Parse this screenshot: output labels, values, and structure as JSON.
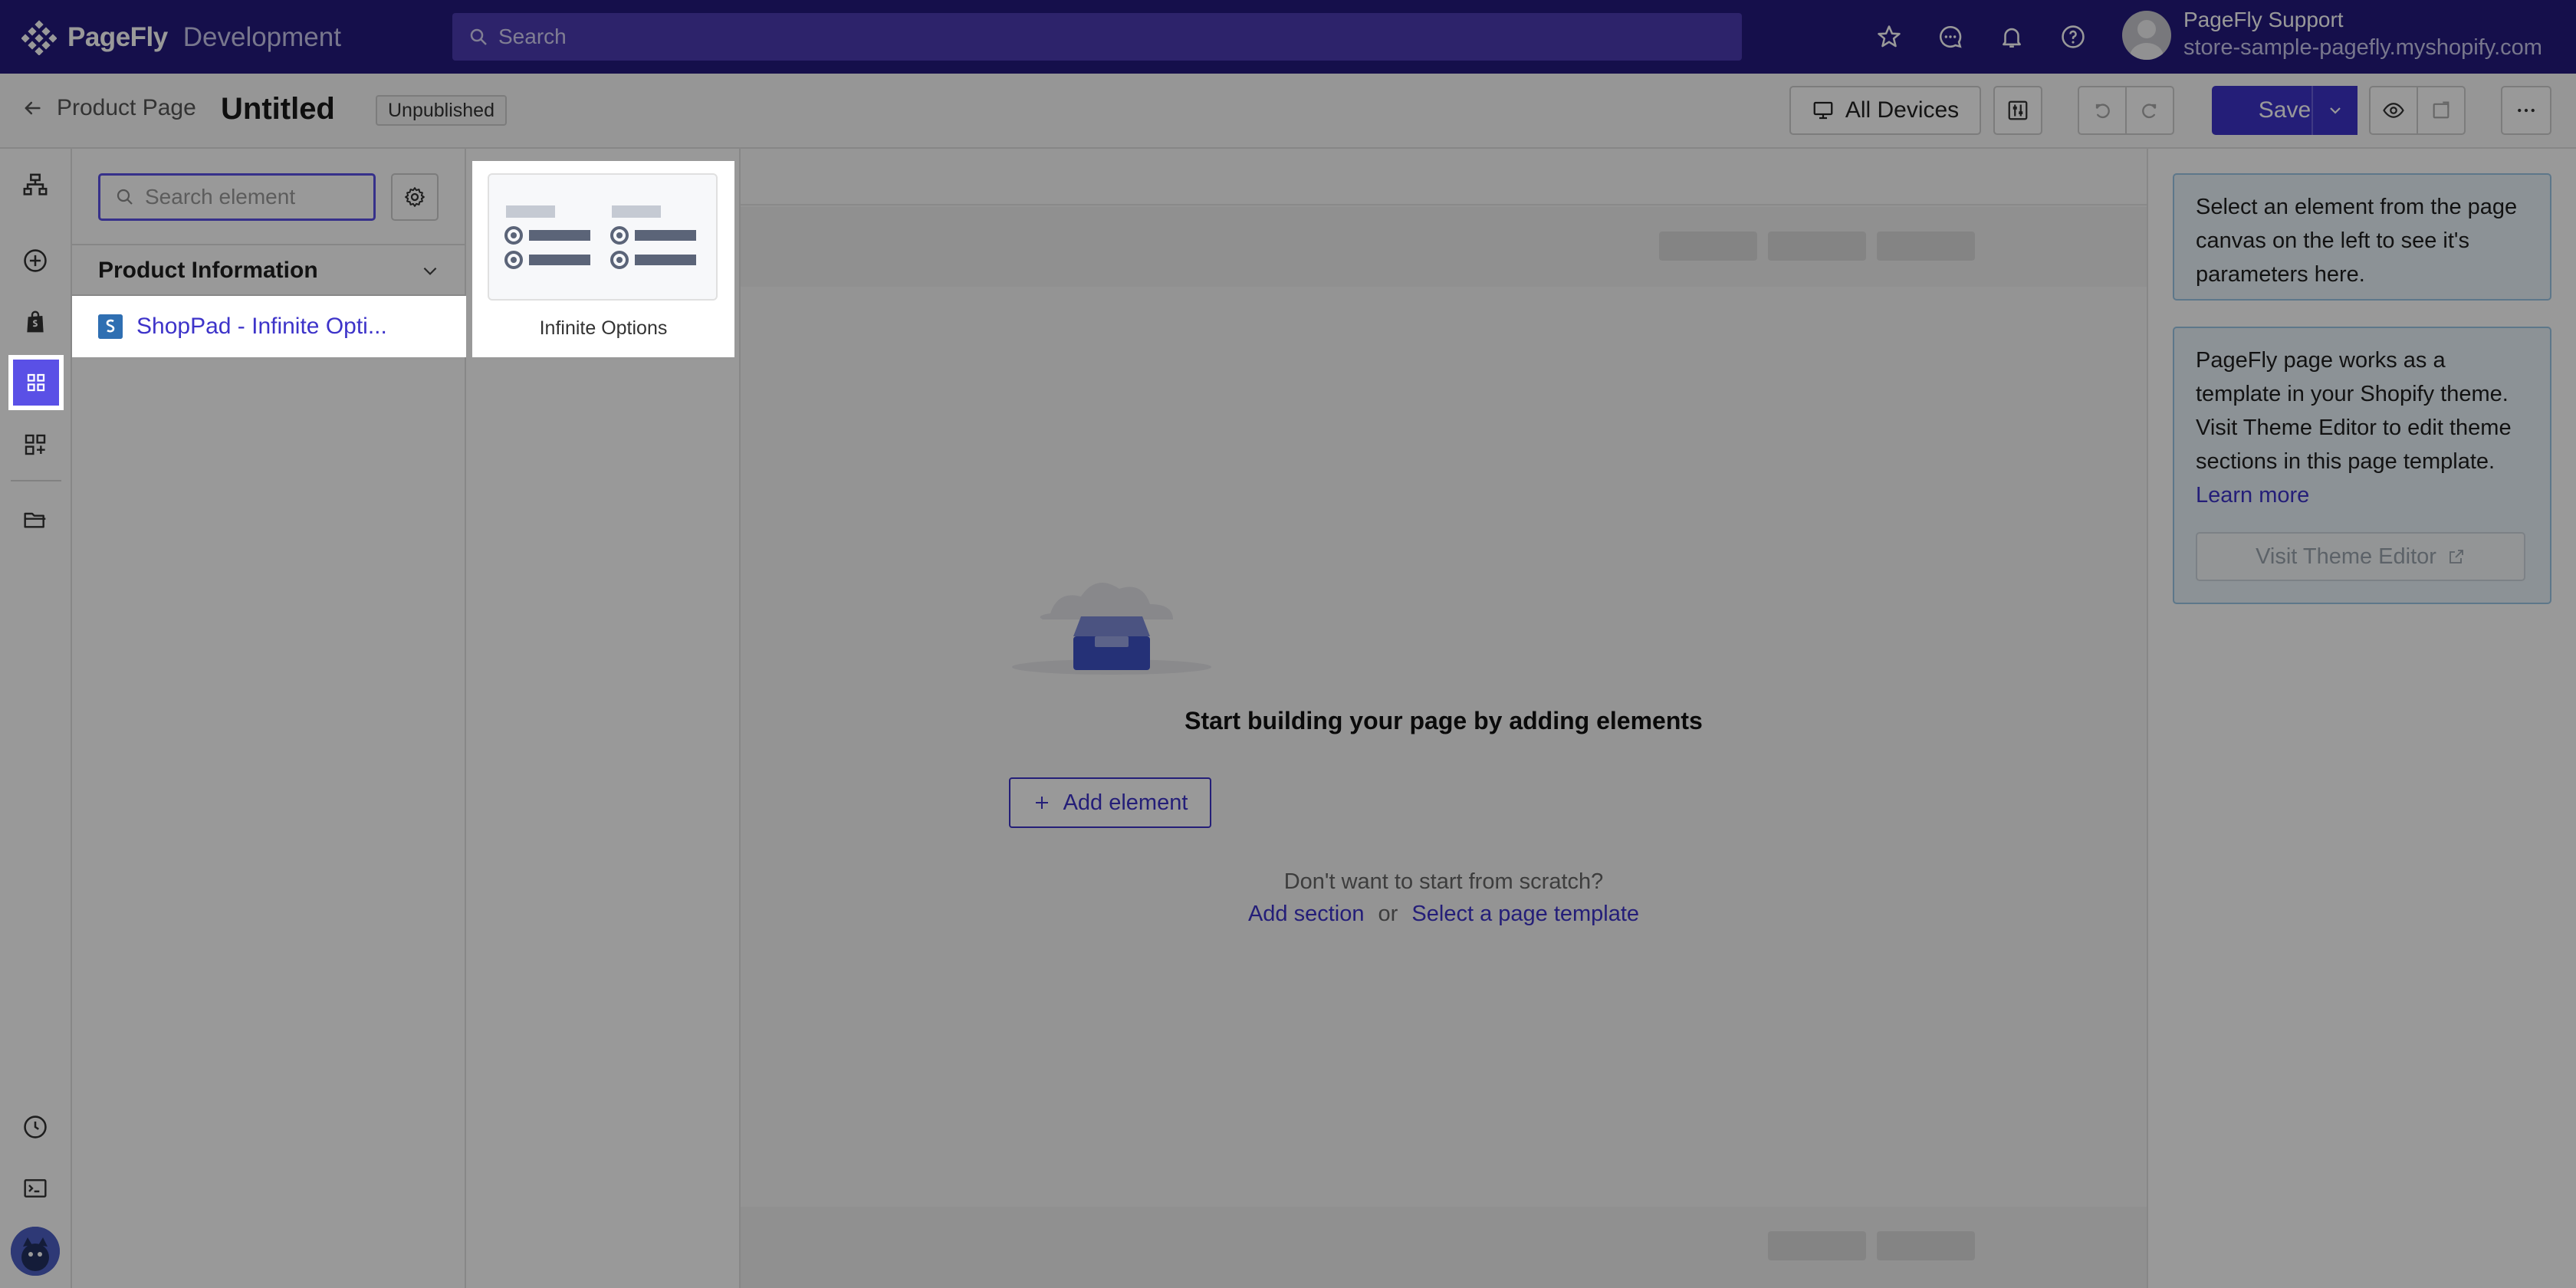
{
  "topbar": {
    "brand_name": "PageFly",
    "brand_env": "Development",
    "search_placeholder": "Search",
    "user_name": "PageFly Support",
    "user_store": "store-sample-pagefly.myshopify.com"
  },
  "header": {
    "back_label": "Product Page",
    "page_title": "Untitled",
    "status": "Unpublished",
    "devices_label": "All Devices",
    "save_label": "Save"
  },
  "panel": {
    "search_placeholder": "Search element",
    "category_title": "Product Information",
    "items": [
      {
        "label": "ShopPad - Infinite Opti..."
      }
    ],
    "preview_label": "Infinite Options"
  },
  "canvas": {
    "empty_title": "Start building your page by adding elements",
    "add_element_label": "Add element",
    "scratch_text": "Don't want to start from scratch?",
    "add_section_label": "Add section",
    "or_text": "or",
    "template_label": "Select a page template"
  },
  "rightpanel": {
    "info1": "Select an element from the page canvas on the left to see it's parameters here.",
    "info2_text": "PageFly page works as a template in your Shopify theme. Visit Theme Editor to edit theme sections in this page template.",
    "learn_more": "Learn more",
    "theme_editor_label": "Visit Theme Editor"
  },
  "colors": {
    "nav_bg": "#231a7d",
    "accent": "#3d33c9",
    "active_rail": "#5a50e6"
  }
}
